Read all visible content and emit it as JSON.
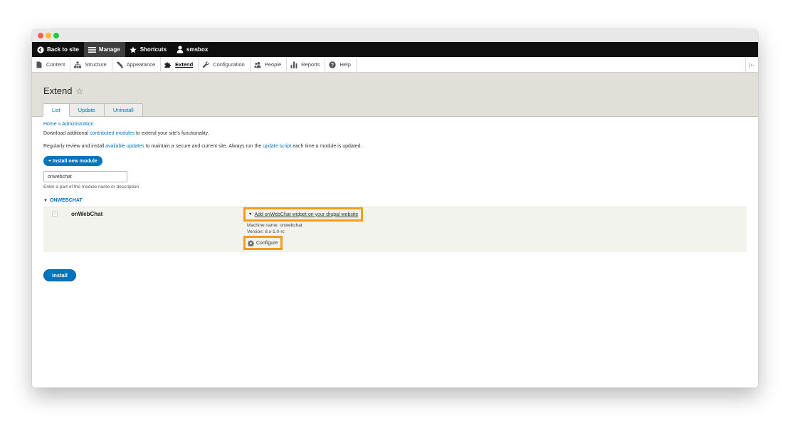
{
  "toolbar": {
    "back": "Back to site",
    "manage": "Manage",
    "shortcuts": "Shortcuts",
    "user": "smsbox"
  },
  "tray": {
    "items": [
      "Content",
      "Structure",
      "Appearance",
      "Extend",
      "Configuration",
      "People",
      "Reports",
      "Help"
    ],
    "active": "Extend"
  },
  "page": {
    "title": "Extend",
    "tabs": [
      "List",
      "Update",
      "Uninstall"
    ]
  },
  "breadcrumb": {
    "home": "Home",
    "separator": "»",
    "admin": "Administration"
  },
  "intro1": {
    "before": "Download additional ",
    "link": "contributed modules",
    "after": " to extend your site's functionality."
  },
  "intro2": {
    "before": "Regularly review and install ",
    "link1": "available updates",
    "middle": " to maintain a secure and current site. Always run the ",
    "link2": "update script",
    "after": " each time a module is updated."
  },
  "install_new": "+ Install new module",
  "filter": {
    "value": "onwebchat",
    "description": "Enter a part of the module name or description"
  },
  "group": {
    "name": "ONWEBCHAT"
  },
  "module": {
    "name": "onWebChat",
    "description": "Add onWebChat widget on your drupal website",
    "machine_name": "Machine name: onwebchat",
    "version": "Version: 8.x-1.0-rc",
    "configure": "Configure"
  },
  "install_button": "Install",
  "colors": {
    "accent": "#0074bd",
    "highlight": "#f39c1e",
    "toolbar": "#0f0f0f"
  }
}
